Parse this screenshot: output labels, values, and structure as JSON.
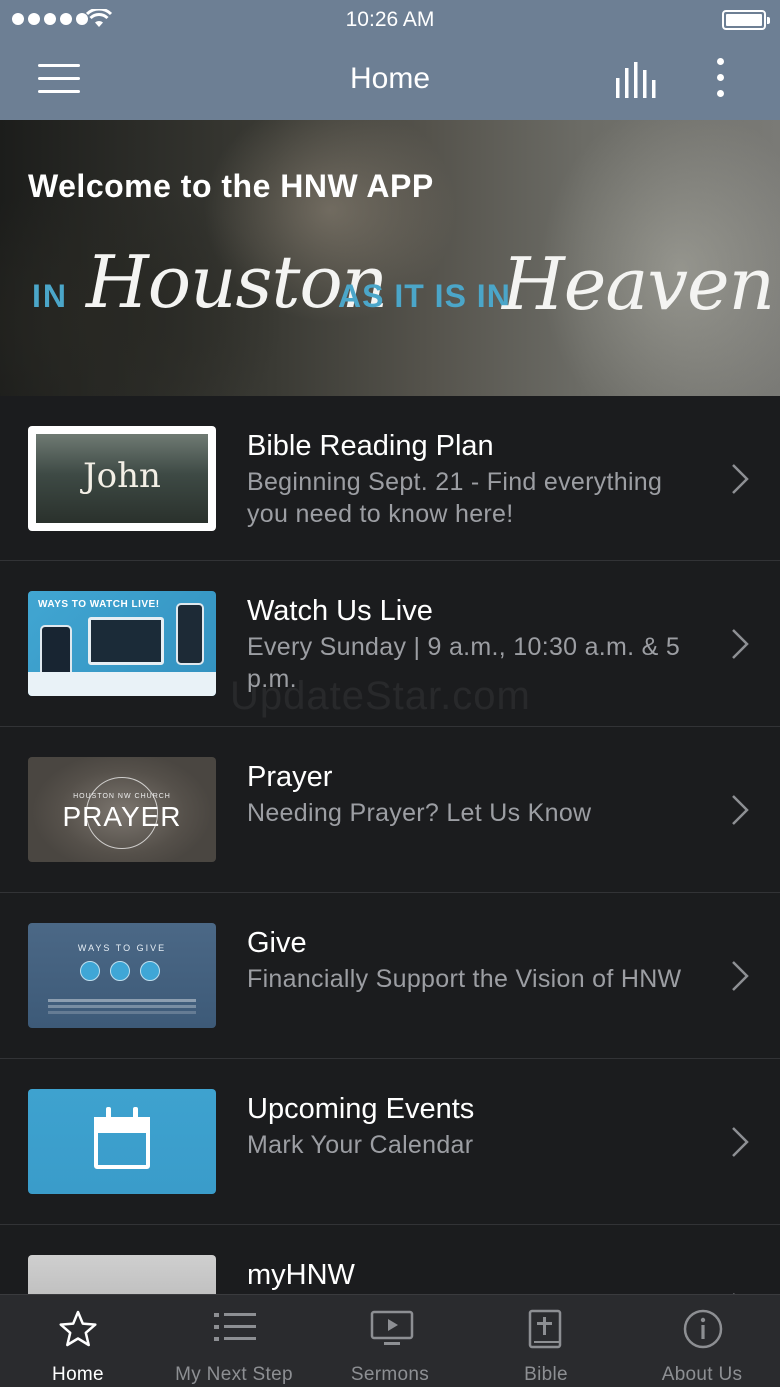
{
  "status_bar": {
    "time": "10:26 AM"
  },
  "nav": {
    "title": "Home"
  },
  "hero": {
    "welcome": "Welcome to the HNW APP",
    "in": "IN",
    "houston": "Houston",
    "middle": "AS IT IS IN",
    "heaven": "Heaven."
  },
  "list": [
    {
      "title": "Bible Reading Plan",
      "subtitle": "Beginning Sept. 21 - Find everything you need to know here!",
      "thumb_text": "John"
    },
    {
      "title": "Watch Us Live",
      "subtitle": "Every Sunday | 9 a.m., 10:30 a.m. & 5 p.m.",
      "thumb_text": "WAYS TO WATCH LIVE!"
    },
    {
      "title": "Prayer",
      "subtitle": "Needing Prayer? Let Us Know",
      "thumb_text": "PRAYER",
      "thumb_small": "HOUSTON NW CHURCH"
    },
    {
      "title": "Give",
      "subtitle": "Financially Support the Vision of HNW",
      "thumb_text": "WAYS TO GIVE"
    },
    {
      "title": "Upcoming Events",
      "subtitle": "Mark Your Calendar"
    },
    {
      "title": "myHNW",
      "subtitle": ""
    }
  ],
  "watermark": "UpdateStar.com",
  "tabs": [
    {
      "label": "Home",
      "icon": "star-icon",
      "active": true
    },
    {
      "label": "My Next Step",
      "icon": "list-icon",
      "active": false
    },
    {
      "label": "Sermons",
      "icon": "tv-play-icon",
      "active": false
    },
    {
      "label": "Bible",
      "icon": "bible-icon",
      "active": false
    },
    {
      "label": "About Us",
      "icon": "info-icon",
      "active": false
    }
  ],
  "colors": {
    "nav_bar": "#6d7f94",
    "background": "#1b1c1e",
    "accent_blue": "#4ba6c9",
    "tab_bar": "#2a2b2e"
  }
}
